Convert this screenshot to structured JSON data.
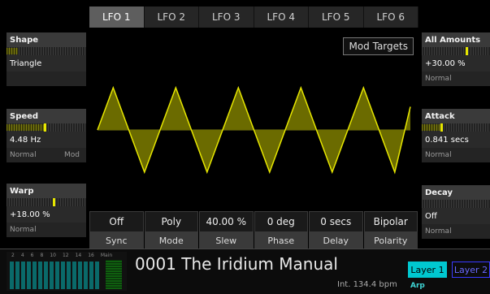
{
  "tabs": [
    "LFO 1",
    "LFO 2",
    "LFO 3",
    "LFO 4",
    "LFO 5",
    "LFO 6"
  ],
  "active_tab": 0,
  "left_panel": {
    "shape": {
      "label": "Shape",
      "value": "Triangle",
      "level": 0.14
    },
    "speed": {
      "label": "Speed",
      "value": "4.48 Hz",
      "sub_left": "Normal",
      "sub_right": "Mod",
      "level": 0.48
    },
    "warp": {
      "label": "Warp",
      "value": "+18.00 %",
      "sub_left": "Normal",
      "level": 0.59
    }
  },
  "right_panel": {
    "all_amounts": {
      "label": "All Amounts",
      "value": "+30.00 %",
      "sub": "Normal",
      "level": 0.65
    },
    "attack": {
      "label": "Attack",
      "value": "0.841 secs",
      "sub": "Normal",
      "level": 0.28
    },
    "decay": {
      "label": "Decay",
      "value": "Off",
      "sub": "Normal",
      "level": 0.0
    }
  },
  "display": {
    "mod_targets_label": "Mod Targets",
    "waveform": "triangle",
    "cycles": 5
  },
  "params": [
    {
      "value": "Off",
      "label": "Sync"
    },
    {
      "value": "Poly",
      "label": "Mode"
    },
    {
      "value": "40.00 %",
      "label": "Slew"
    },
    {
      "value": "0 deg",
      "label": "Phase"
    },
    {
      "value": "0 secs",
      "label": "Delay"
    },
    {
      "value": "Bipolar",
      "label": "Polarity"
    }
  ],
  "meter": {
    "scale": [
      "2",
      "4",
      "6",
      "8",
      "10",
      "12",
      "14",
      "16",
      "Main"
    ]
  },
  "patch": {
    "name": "0001 The Iridium Manual",
    "tempo": "Int. 134.4 bpm"
  },
  "layers": {
    "layer1": "Layer 1",
    "layer2": "Layer 2",
    "arp": "Arp"
  },
  "colors": {
    "accent": "#e6e600",
    "wave_fill": "#6b6b00",
    "layer": "#00c8d0"
  }
}
